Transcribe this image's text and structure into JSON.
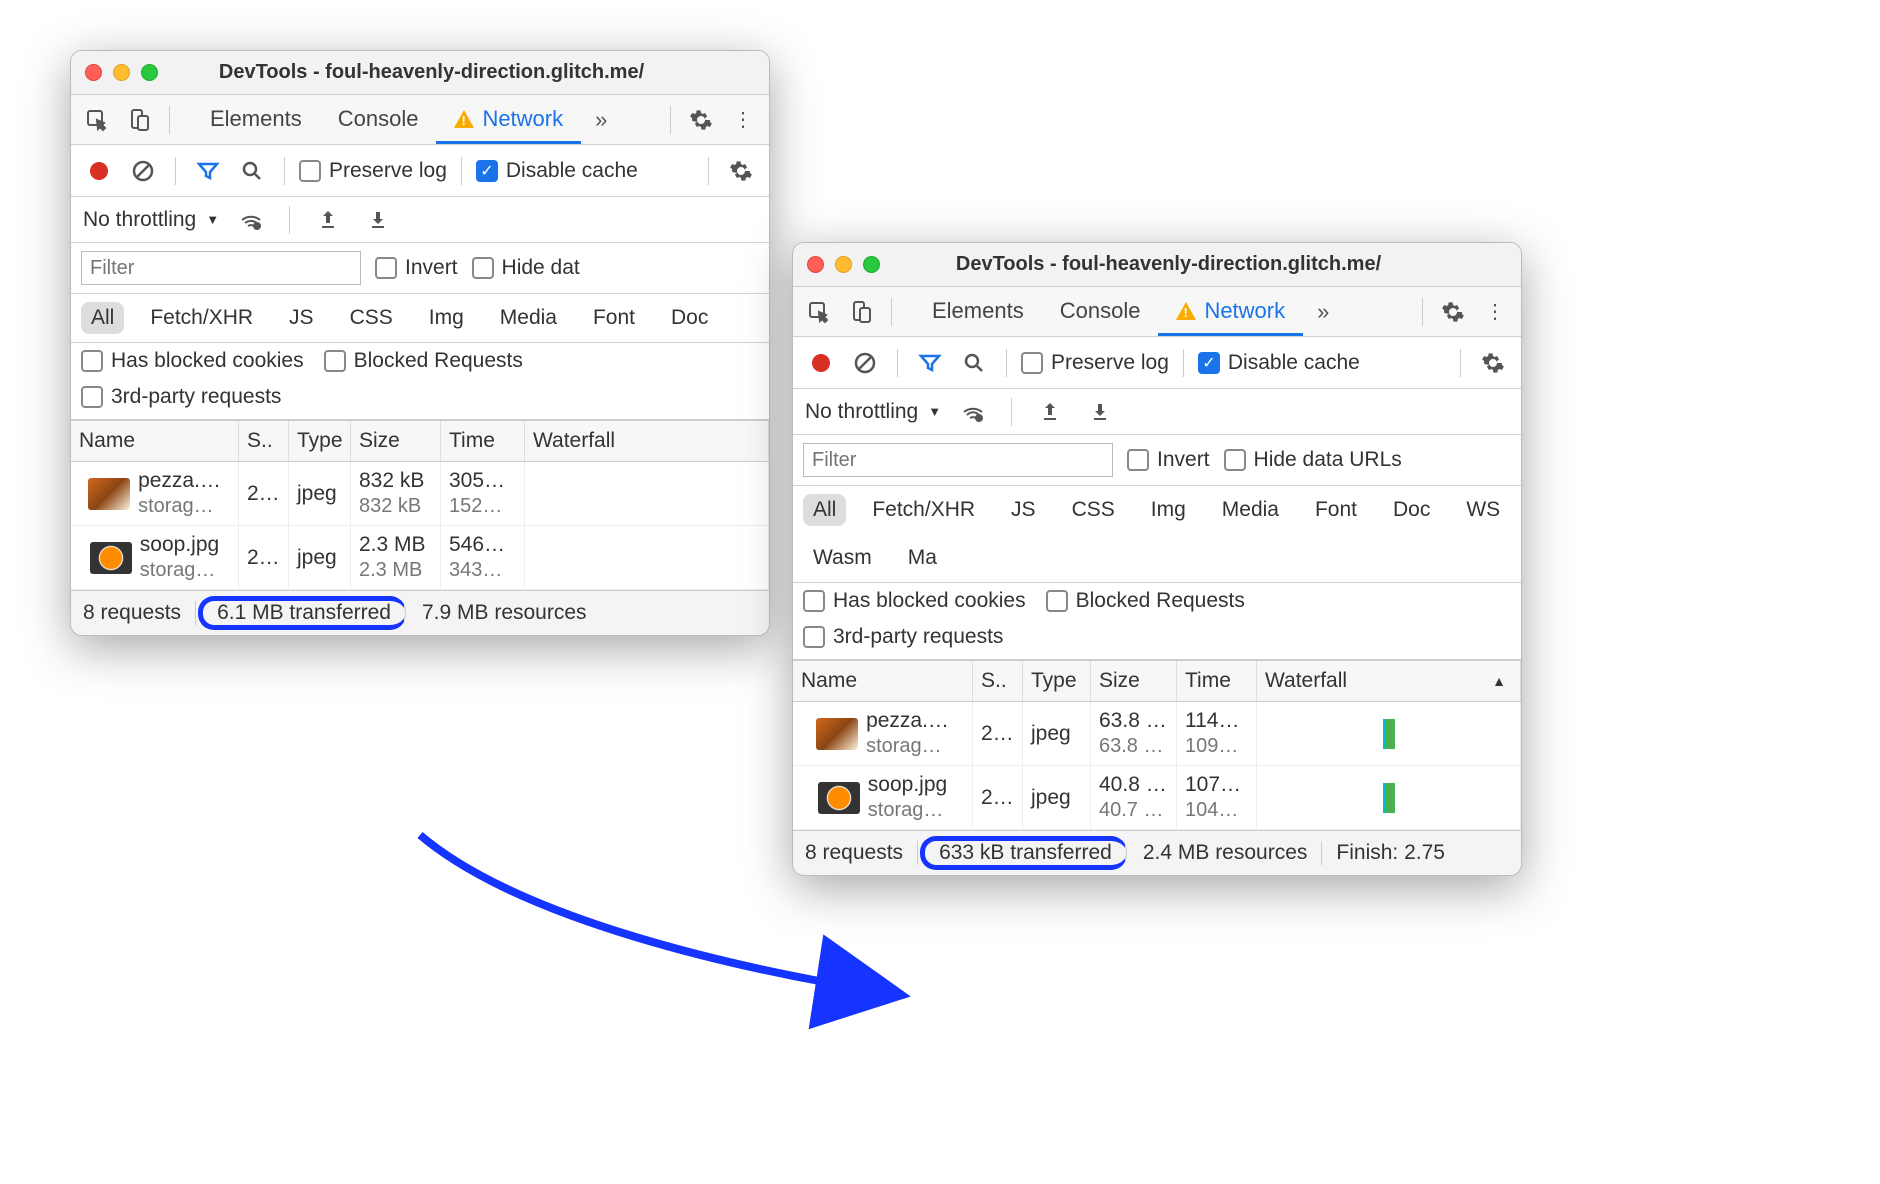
{
  "window1": {
    "title": "DevTools - foul-heavenly-direction.glitch.me/",
    "tabs": {
      "elements": "Elements",
      "console": "Console",
      "network": "Network"
    },
    "toolbar": {
      "preserve": "Preserve log",
      "disable": "Disable cache"
    },
    "throttle": "No throttling",
    "filter_placeholder": "Filter",
    "invert": "Invert",
    "hide": "Hide dat",
    "types": [
      "All",
      "Fetch/XHR",
      "JS",
      "CSS",
      "Img",
      "Media",
      "Font",
      "Doc"
    ],
    "opts": {
      "blocked": "Has blocked cookies",
      "blockedr": "Blocked Requests",
      "third": "3rd-party requests"
    },
    "cols": {
      "name": "Name",
      "status": "S..",
      "type": "Type",
      "size": "Size",
      "time": "Time",
      "waterfall": "Waterfall"
    },
    "rows": [
      {
        "name": "pezza.…",
        "domain": "storag…",
        "status": "2…",
        "type": "jpeg",
        "size": "832 kB",
        "size2": "832 kB",
        "time": "305…",
        "time2": "152…"
      },
      {
        "name": "soop.jpg",
        "domain": "storag…",
        "status": "2…",
        "type": "jpeg",
        "size": "2.3 MB",
        "size2": "2.3 MB",
        "time": "546…",
        "time2": "343…"
      }
    ],
    "status": {
      "reqs": "8 requests",
      "xfer": "6.1 MB transferred",
      "res": "7.9 MB resources"
    }
  },
  "window2": {
    "title": "DevTools - foul-heavenly-direction.glitch.me/",
    "tabs": {
      "elements": "Elements",
      "console": "Console",
      "network": "Network"
    },
    "toolbar": {
      "preserve": "Preserve log",
      "disable": "Disable cache"
    },
    "throttle": "No throttling",
    "filter_placeholder": "Filter",
    "invert": "Invert",
    "hide": "Hide data URLs",
    "types": [
      "All",
      "Fetch/XHR",
      "JS",
      "CSS",
      "Img",
      "Media",
      "Font",
      "Doc",
      "WS",
      "Wasm",
      "Ma"
    ],
    "opts": {
      "blocked": "Has blocked cookies",
      "blockedr": "Blocked Requests",
      "third": "3rd-party requests"
    },
    "cols": {
      "name": "Name",
      "status": "S..",
      "type": "Type",
      "size": "Size",
      "time": "Time",
      "waterfall": "Waterfall"
    },
    "rows": [
      {
        "name": "pezza.…",
        "domain": "storag…",
        "status": "2…",
        "type": "jpeg",
        "size": "63.8 …",
        "size2": "63.8 …",
        "time": "114…",
        "time2": "109…"
      },
      {
        "name": "soop.jpg",
        "domain": "storag…",
        "status": "2…",
        "type": "jpeg",
        "size": "40.8 …",
        "size2": "40.7 …",
        "time": "107…",
        "time2": "104…"
      }
    ],
    "status": {
      "reqs": "8 requests",
      "xfer": "633 kB transferred",
      "res": "2.4 MB resources",
      "finish": "Finish: 2.75"
    }
  }
}
